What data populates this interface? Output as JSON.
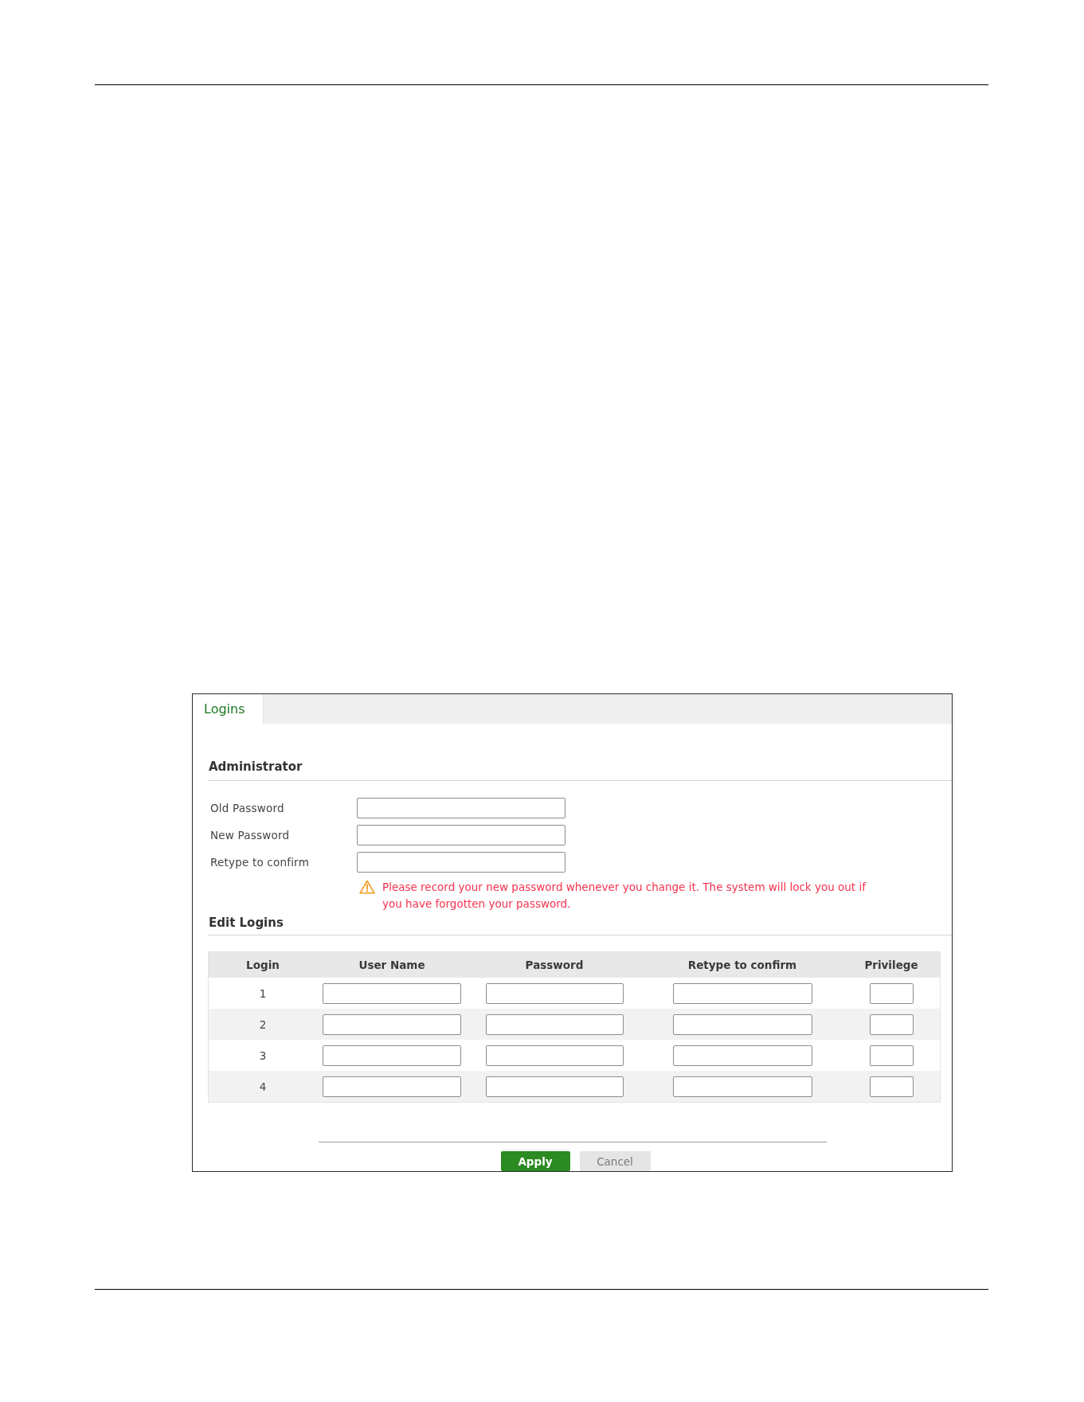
{
  "tab": {
    "label": "Logins",
    "selected": true
  },
  "administrator": {
    "title": "Administrator",
    "fields": [
      {
        "label": "Old Password"
      },
      {
        "label": "New Password"
      },
      {
        "label": "Retype to confirm"
      }
    ],
    "warning": "Please record your new password whenever you change it. The system will lock you out if you have forgotten your password."
  },
  "edit_logins": {
    "title": "Edit Logins",
    "columns": [
      {
        "label": "Login",
        "kind": "number"
      },
      {
        "label": "User Name",
        "kind": "input"
      },
      {
        "label": "Password",
        "kind": "input"
      },
      {
        "label": "Retype to confirm",
        "kind": "input"
      },
      {
        "label": "Privilege",
        "kind": "input"
      }
    ],
    "rows": [
      {
        "login": "1"
      },
      {
        "login": "2"
      },
      {
        "login": "3"
      },
      {
        "login": "4"
      }
    ]
  },
  "buttons": [
    {
      "label": "Apply",
      "kind": "primary"
    },
    {
      "label": "Cancel",
      "kind": "secondary"
    }
  ]
}
